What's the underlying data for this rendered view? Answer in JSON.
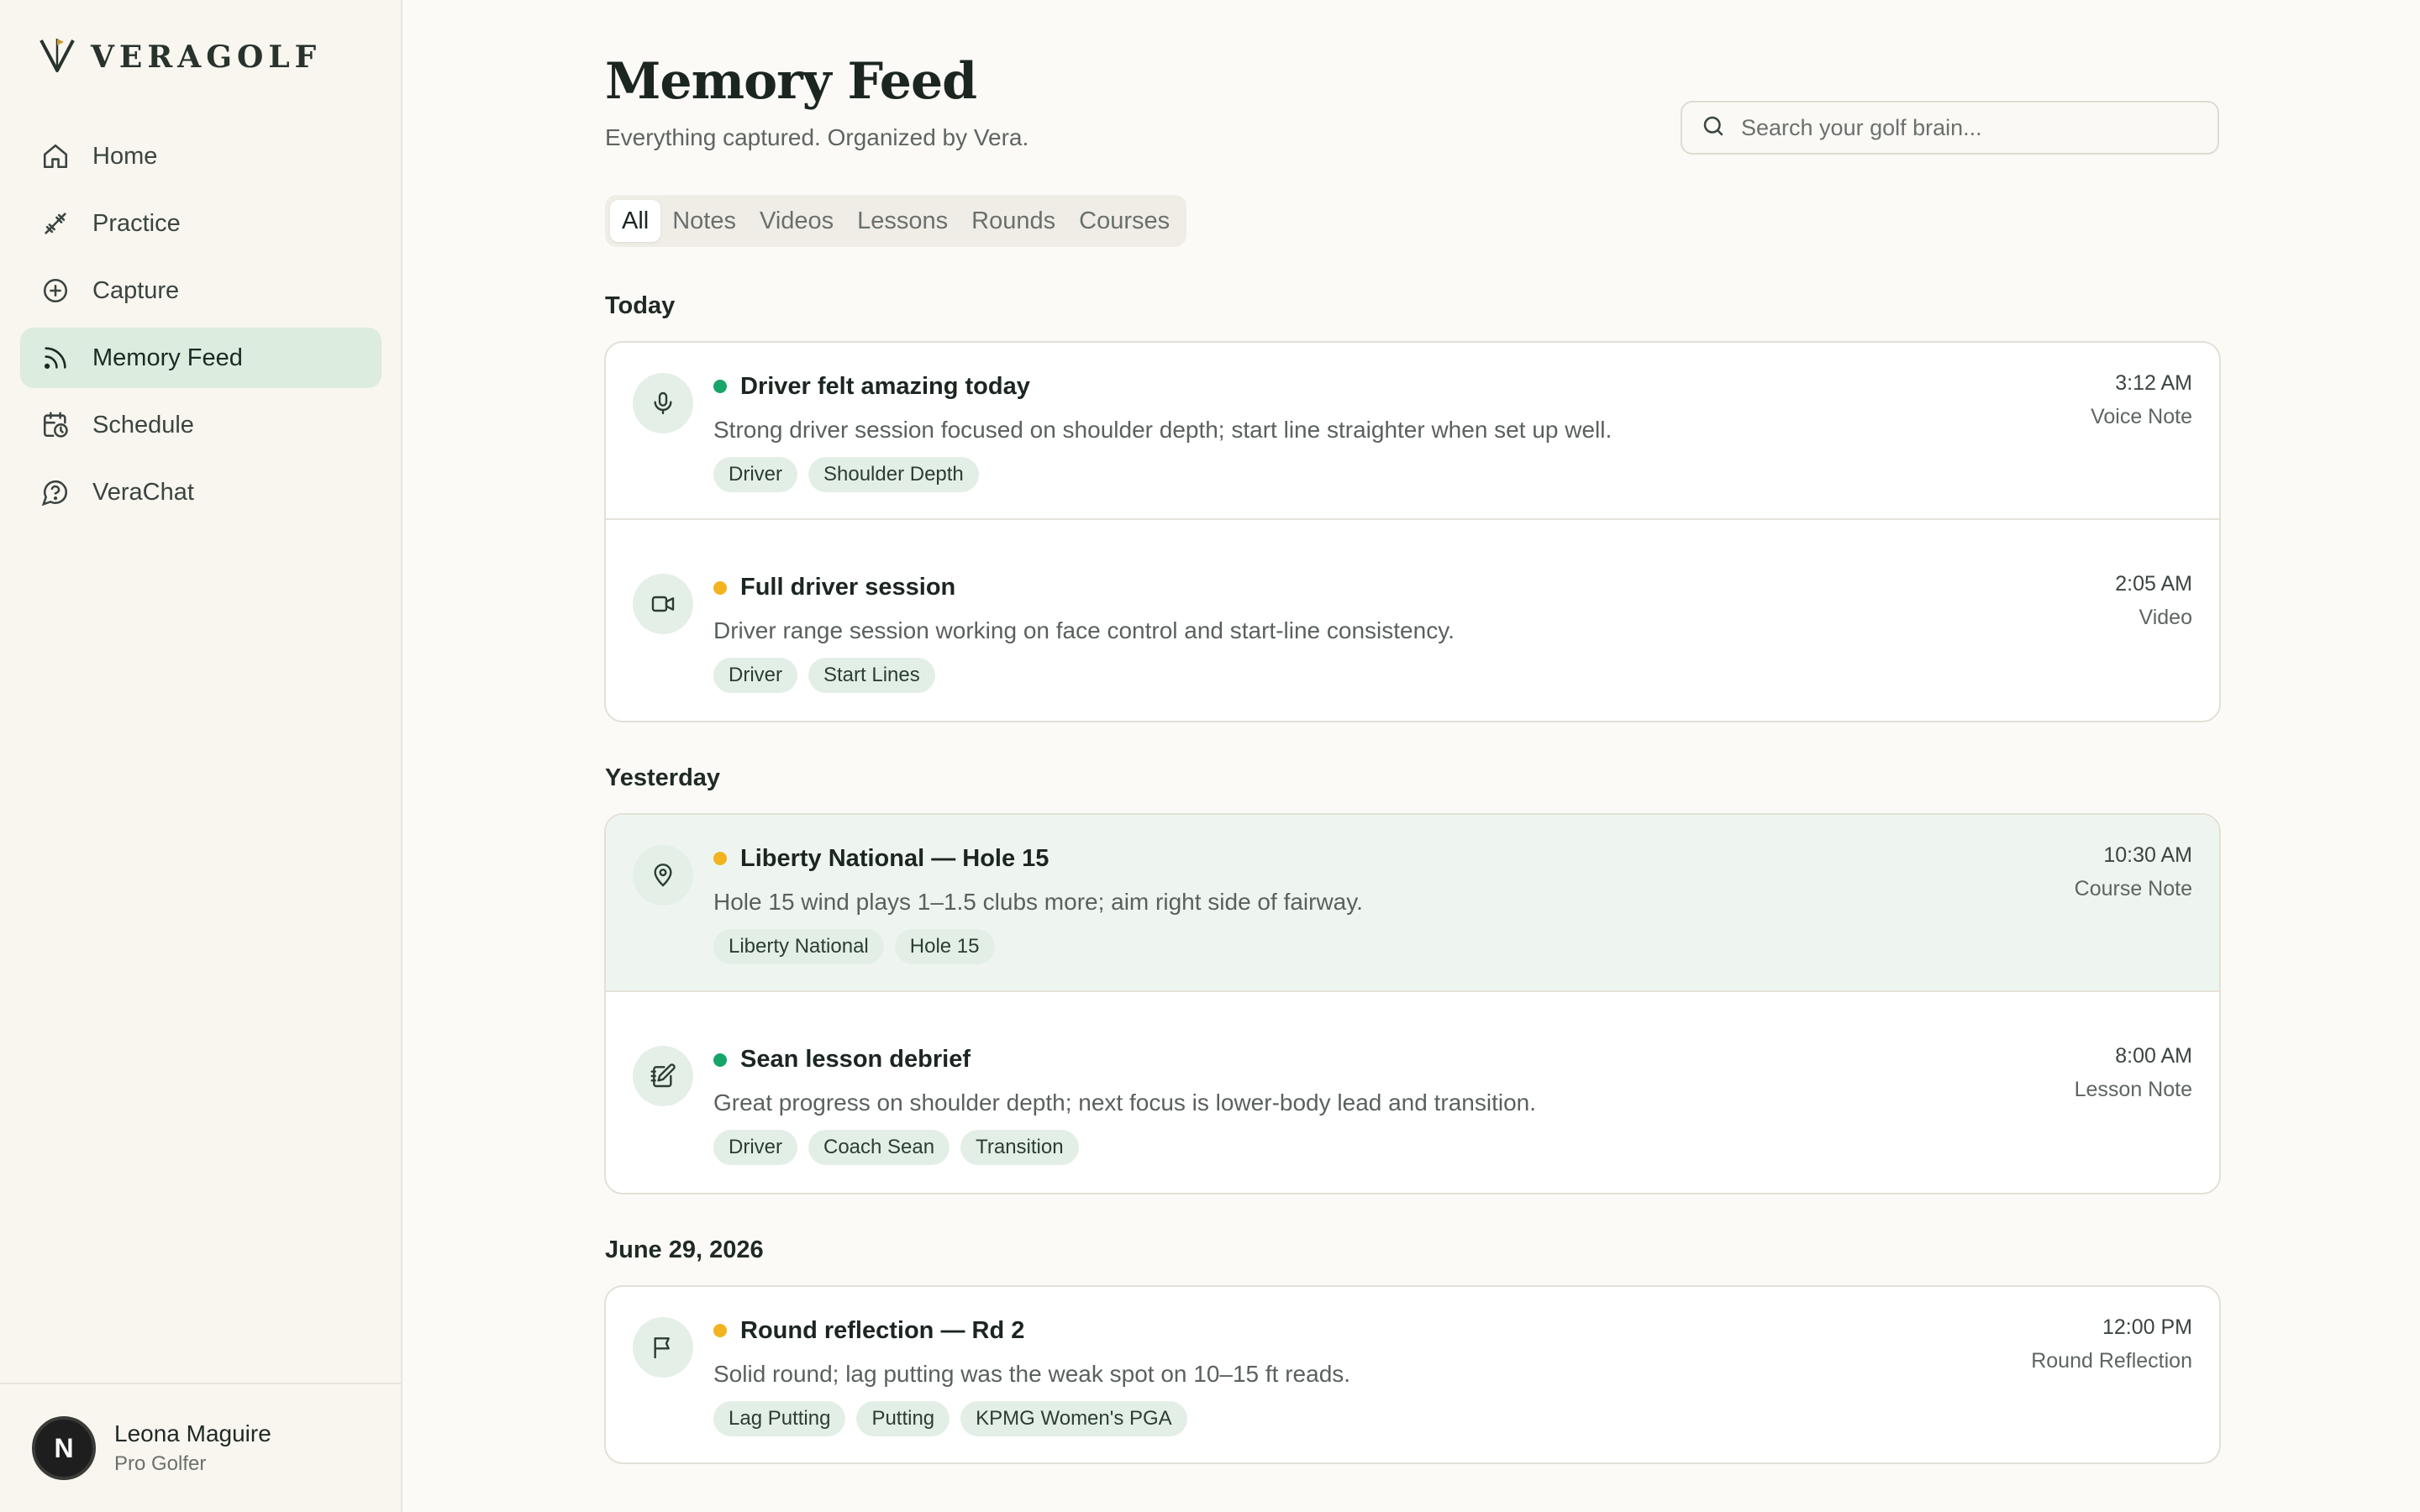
{
  "brand": {
    "name": "VERAGOLF",
    "accent": "#c99a2e"
  },
  "sidebar": {
    "items": [
      {
        "label": "Home",
        "icon": "home-icon",
        "active": false
      },
      {
        "label": "Practice",
        "icon": "dumbbell-icon",
        "active": false
      },
      {
        "label": "Capture",
        "icon": "plus-circle-icon",
        "active": false
      },
      {
        "label": "Memory Feed",
        "icon": "rss-icon",
        "active": true
      },
      {
        "label": "Schedule",
        "icon": "calendar-clock-icon",
        "active": false
      },
      {
        "label": "VeraChat",
        "icon": "chat-question-icon",
        "active": false
      }
    ],
    "profile": {
      "initial": "N",
      "name": "Leona Maguire",
      "role": "Pro Golfer"
    }
  },
  "header": {
    "title": "Memory Feed",
    "subtitle": "Everything captured. Organized by Vera.",
    "search_placeholder": "Search your golf brain..."
  },
  "tabs": [
    "All",
    "Notes",
    "Videos",
    "Lessons",
    "Rounds",
    "Courses"
  ],
  "active_tab": "All",
  "colors": {
    "dot_green": "#18a56a",
    "dot_amber": "#f2b31e",
    "active_nav": "#dcecdf",
    "highlight": "#eef5f0"
  },
  "groups": [
    {
      "label": "Today",
      "entries": [
        {
          "title": "Driver felt amazing today",
          "desc": "Strong driver session focused on shoulder depth; start line straighter when set up well.",
          "tags": [
            "Driver",
            "Shoulder Depth"
          ],
          "time": "3:12 AM",
          "type": "Voice Note",
          "icon": "microphone-icon",
          "dot": "green",
          "highlight": false
        },
        {
          "title": "Full driver session",
          "desc": "Driver range session working on face control and start-line consistency.",
          "tags": [
            "Driver",
            "Start Lines"
          ],
          "time": "2:05 AM",
          "type": "Video",
          "icon": "video-camera-icon",
          "dot": "amber",
          "highlight": false
        }
      ]
    },
    {
      "label": "Yesterday",
      "entries": [
        {
          "title": "Liberty National — Hole 15",
          "desc": "Hole 15 wind plays 1–1.5 clubs more; aim right side of fairway.",
          "tags": [
            "Liberty National",
            "Hole 15"
          ],
          "time": "10:30 AM",
          "type": "Course Note",
          "icon": "map-pin-icon",
          "dot": "amber",
          "highlight": true
        },
        {
          "title": "Sean lesson debrief",
          "desc": "Great progress on shoulder depth; next focus is lower-body lead and transition.",
          "tags": [
            "Driver",
            "Coach Sean",
            "Transition"
          ],
          "time": "8:00 AM",
          "type": "Lesson Note",
          "icon": "notebook-pen-icon",
          "dot": "green",
          "highlight": false
        }
      ]
    },
    {
      "label": "June 29, 2026",
      "entries": [
        {
          "title": "Round reflection — Rd 2",
          "desc": "Solid round; lag putting was the weak spot on 10–15 ft reads.",
          "tags": [
            "Lag Putting",
            "Putting",
            "KPMG Women's PGA"
          ],
          "time": "12:00 PM",
          "type": "Round Reflection",
          "icon": "flag-icon",
          "dot": "amber",
          "highlight": false
        }
      ]
    }
  ]
}
